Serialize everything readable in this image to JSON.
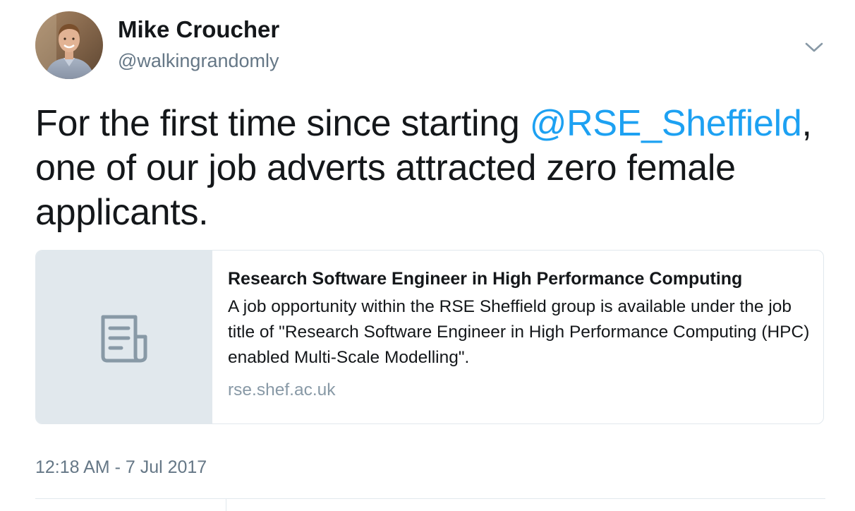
{
  "tweet": {
    "author": {
      "display_name": "Mike Croucher",
      "handle": "@walkingrandomly"
    },
    "text": {
      "part1": "For the first time since starting ",
      "mention": "@RSE_Sheffield",
      "part2": ", one of our job adverts attracted zero female applicants."
    },
    "card": {
      "title": "Research Software Engineer in High Performance Computing",
      "description": "A job opportunity within the RSE Sheffield group is available under the job title of \"Research Software Engineer in High Performance Computing (HPC) enabled Multi-Scale Modelling\".",
      "domain": "rse.shef.ac.uk",
      "thumbnail_icon": "document-icon"
    },
    "timestamp": "12:18 AM - 7 Jul 2017",
    "menu_icon": "chevron-down-icon"
  },
  "colors": {
    "link": "#1da1f2",
    "secondary_text": "#657786",
    "card_border": "#e1e8ed",
    "card_thumb_bg": "#e1e8ed",
    "card_icon": "#8899a6"
  }
}
